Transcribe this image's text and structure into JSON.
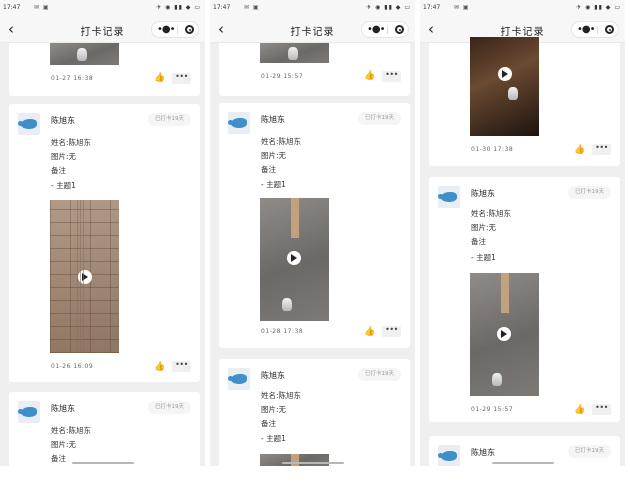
{
  "status": {
    "screen1_time": "17:47",
    "screen2_time": "17:47",
    "screen3_time": "17:47"
  },
  "nav": {
    "title": "打卡记录",
    "back_icon": "chevron-left-icon",
    "more_icon": "more-dots-icon",
    "target_icon": "target-icon"
  },
  "labels": {
    "name_prefix": "姓名:",
    "image_prefix": "图片:",
    "image_value": "无",
    "remark": "备注",
    "topic": "- 主题1"
  },
  "user_name": "陈旭东",
  "badge_text": "已打卡19天",
  "screens": [
    {
      "cards": [
        {
          "date": "01-27 16:38"
        },
        {
          "date": "01-26 16:09"
        },
        {
          "partial": true
        }
      ]
    },
    {
      "cards": [
        {
          "date": "01-29 15:57"
        },
        {
          "date": "01-28 17:38"
        },
        {
          "partial": true
        }
      ]
    },
    {
      "cards": [
        {
          "date": "01-30 17:38"
        },
        {
          "date": "01-29 15:57"
        },
        {
          "partial": true
        }
      ]
    }
  ]
}
